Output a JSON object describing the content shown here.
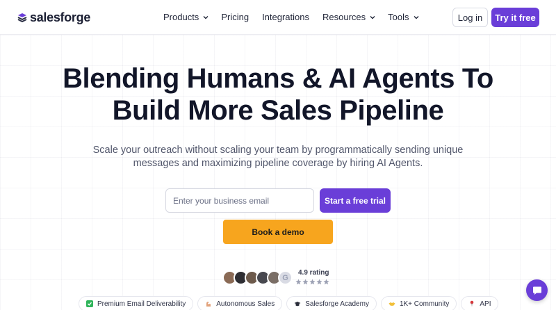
{
  "brand": {
    "name": "salesforge",
    "accent": "#6a3ed8",
    "cta_orange": "#f7a51e"
  },
  "nav": {
    "items": [
      {
        "label": "Products",
        "dropdown": true
      },
      {
        "label": "Pricing",
        "dropdown": false
      },
      {
        "label": "Integrations",
        "dropdown": false
      },
      {
        "label": "Resources",
        "dropdown": true
      },
      {
        "label": "Tools",
        "dropdown": true
      }
    ],
    "login_label": "Log in",
    "try_label": "Try it free"
  },
  "hero": {
    "headline_line1": "Blending Humans & AI Agents To",
    "headline_line2": "Build More Sales Pipeline",
    "subtitle": "Scale your outreach without scaling your team by programmatically sending unique messages and maximizing pipeline coverage by hiring AI Agents.",
    "email_placeholder": "Enter your business email",
    "trial_label": "Start a free trial",
    "demo_label": "Book a demo"
  },
  "rating": {
    "text": "4.9 rating",
    "stars": 5,
    "review_badge": "G"
  },
  "pills": [
    {
      "icon": "check-square-icon",
      "label": "Premium Email Deliverability"
    },
    {
      "icon": "flexed-arm-icon",
      "label": "Autonomous Sales"
    },
    {
      "icon": "graduation-cap-icon",
      "label": "Salesforge Academy"
    },
    {
      "icon": "handshake-icon",
      "label": "1K+ Community"
    },
    {
      "icon": "pin-icon",
      "label": "API"
    }
  ]
}
